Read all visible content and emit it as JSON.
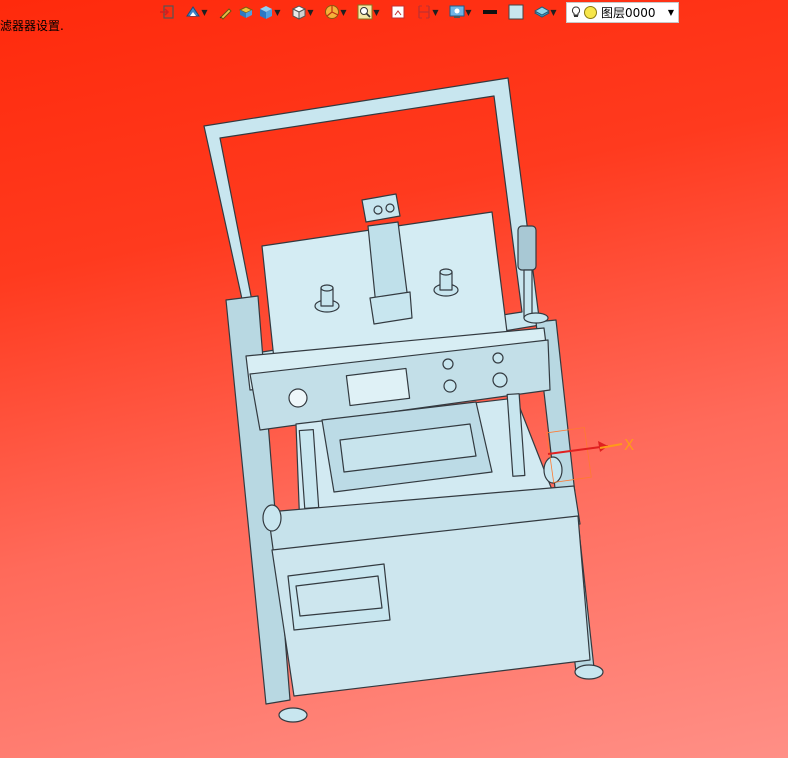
{
  "status": {
    "message": "滤器器设置."
  },
  "toolbar": {
    "tools": [
      {
        "name": "import-icon",
        "has_dropdown": false
      },
      {
        "name": "display-mode-icon",
        "has_dropdown": true
      },
      {
        "name": "pen-icon",
        "has_dropdown": false
      },
      {
        "name": "layer-box-icon",
        "has_dropdown": false
      },
      {
        "name": "cube-icon",
        "has_dropdown": true
      },
      {
        "name": "view-cube-icon",
        "has_dropdown": true
      },
      {
        "name": "pie-section-icon",
        "has_dropdown": true
      },
      {
        "name": "zoom-icon",
        "has_dropdown": true
      },
      {
        "name": "frame-icon",
        "has_dropdown": false
      },
      {
        "name": "ruler-icon",
        "has_dropdown": true
      },
      {
        "name": "screen-icon",
        "has_dropdown": true
      },
      {
        "name": "line-weight-icon",
        "has_dropdown": false
      },
      {
        "name": "color-swatch-icon",
        "has_dropdown": false
      },
      {
        "name": "layer-stack-icon",
        "has_dropdown": true
      }
    ],
    "layer_selector": {
      "value": "图层0000"
    }
  },
  "viewport": {
    "axis_label": "X"
  },
  "colors": {
    "background_top": "#ff2a0c",
    "background_bottom": "#ff8f86",
    "model_fill": "#c8e6ef",
    "model_stroke": "#333a40",
    "axis_x": "#e02020",
    "axis_label": "#ff9a1a"
  }
}
